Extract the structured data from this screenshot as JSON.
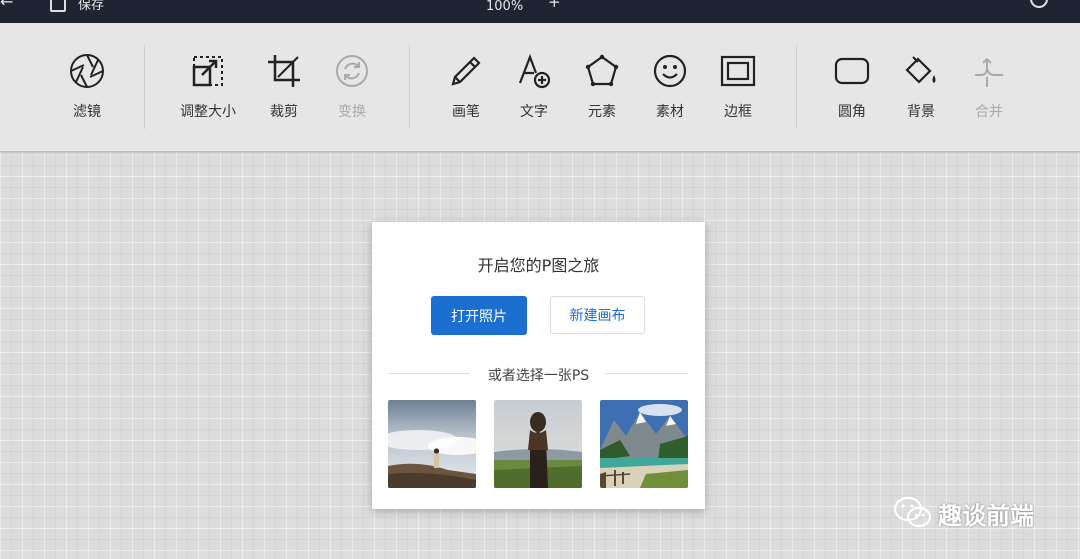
{
  "topbar": {
    "zoom": "100%",
    "save_label": "保存"
  },
  "toolbar": {
    "filter": "滤镜",
    "resize": "调整大小",
    "crop": "裁剪",
    "transform": "变换",
    "brush": "画笔",
    "text": "文字",
    "element": "元素",
    "material": "素材",
    "border": "边框",
    "corner": "圆角",
    "background": "背景",
    "merge": "合并"
  },
  "dialog": {
    "title": "开启您的P图之旅",
    "open_photo": "打开照片",
    "new_canvas": "新建画布",
    "or_choose": "或者选择一张PS"
  },
  "watermark": {
    "text": "趣谈前端"
  },
  "colors": {
    "primary": "#1a6fd1",
    "topbar": "#1f2433",
    "toolbar": "#e6e6e6"
  }
}
